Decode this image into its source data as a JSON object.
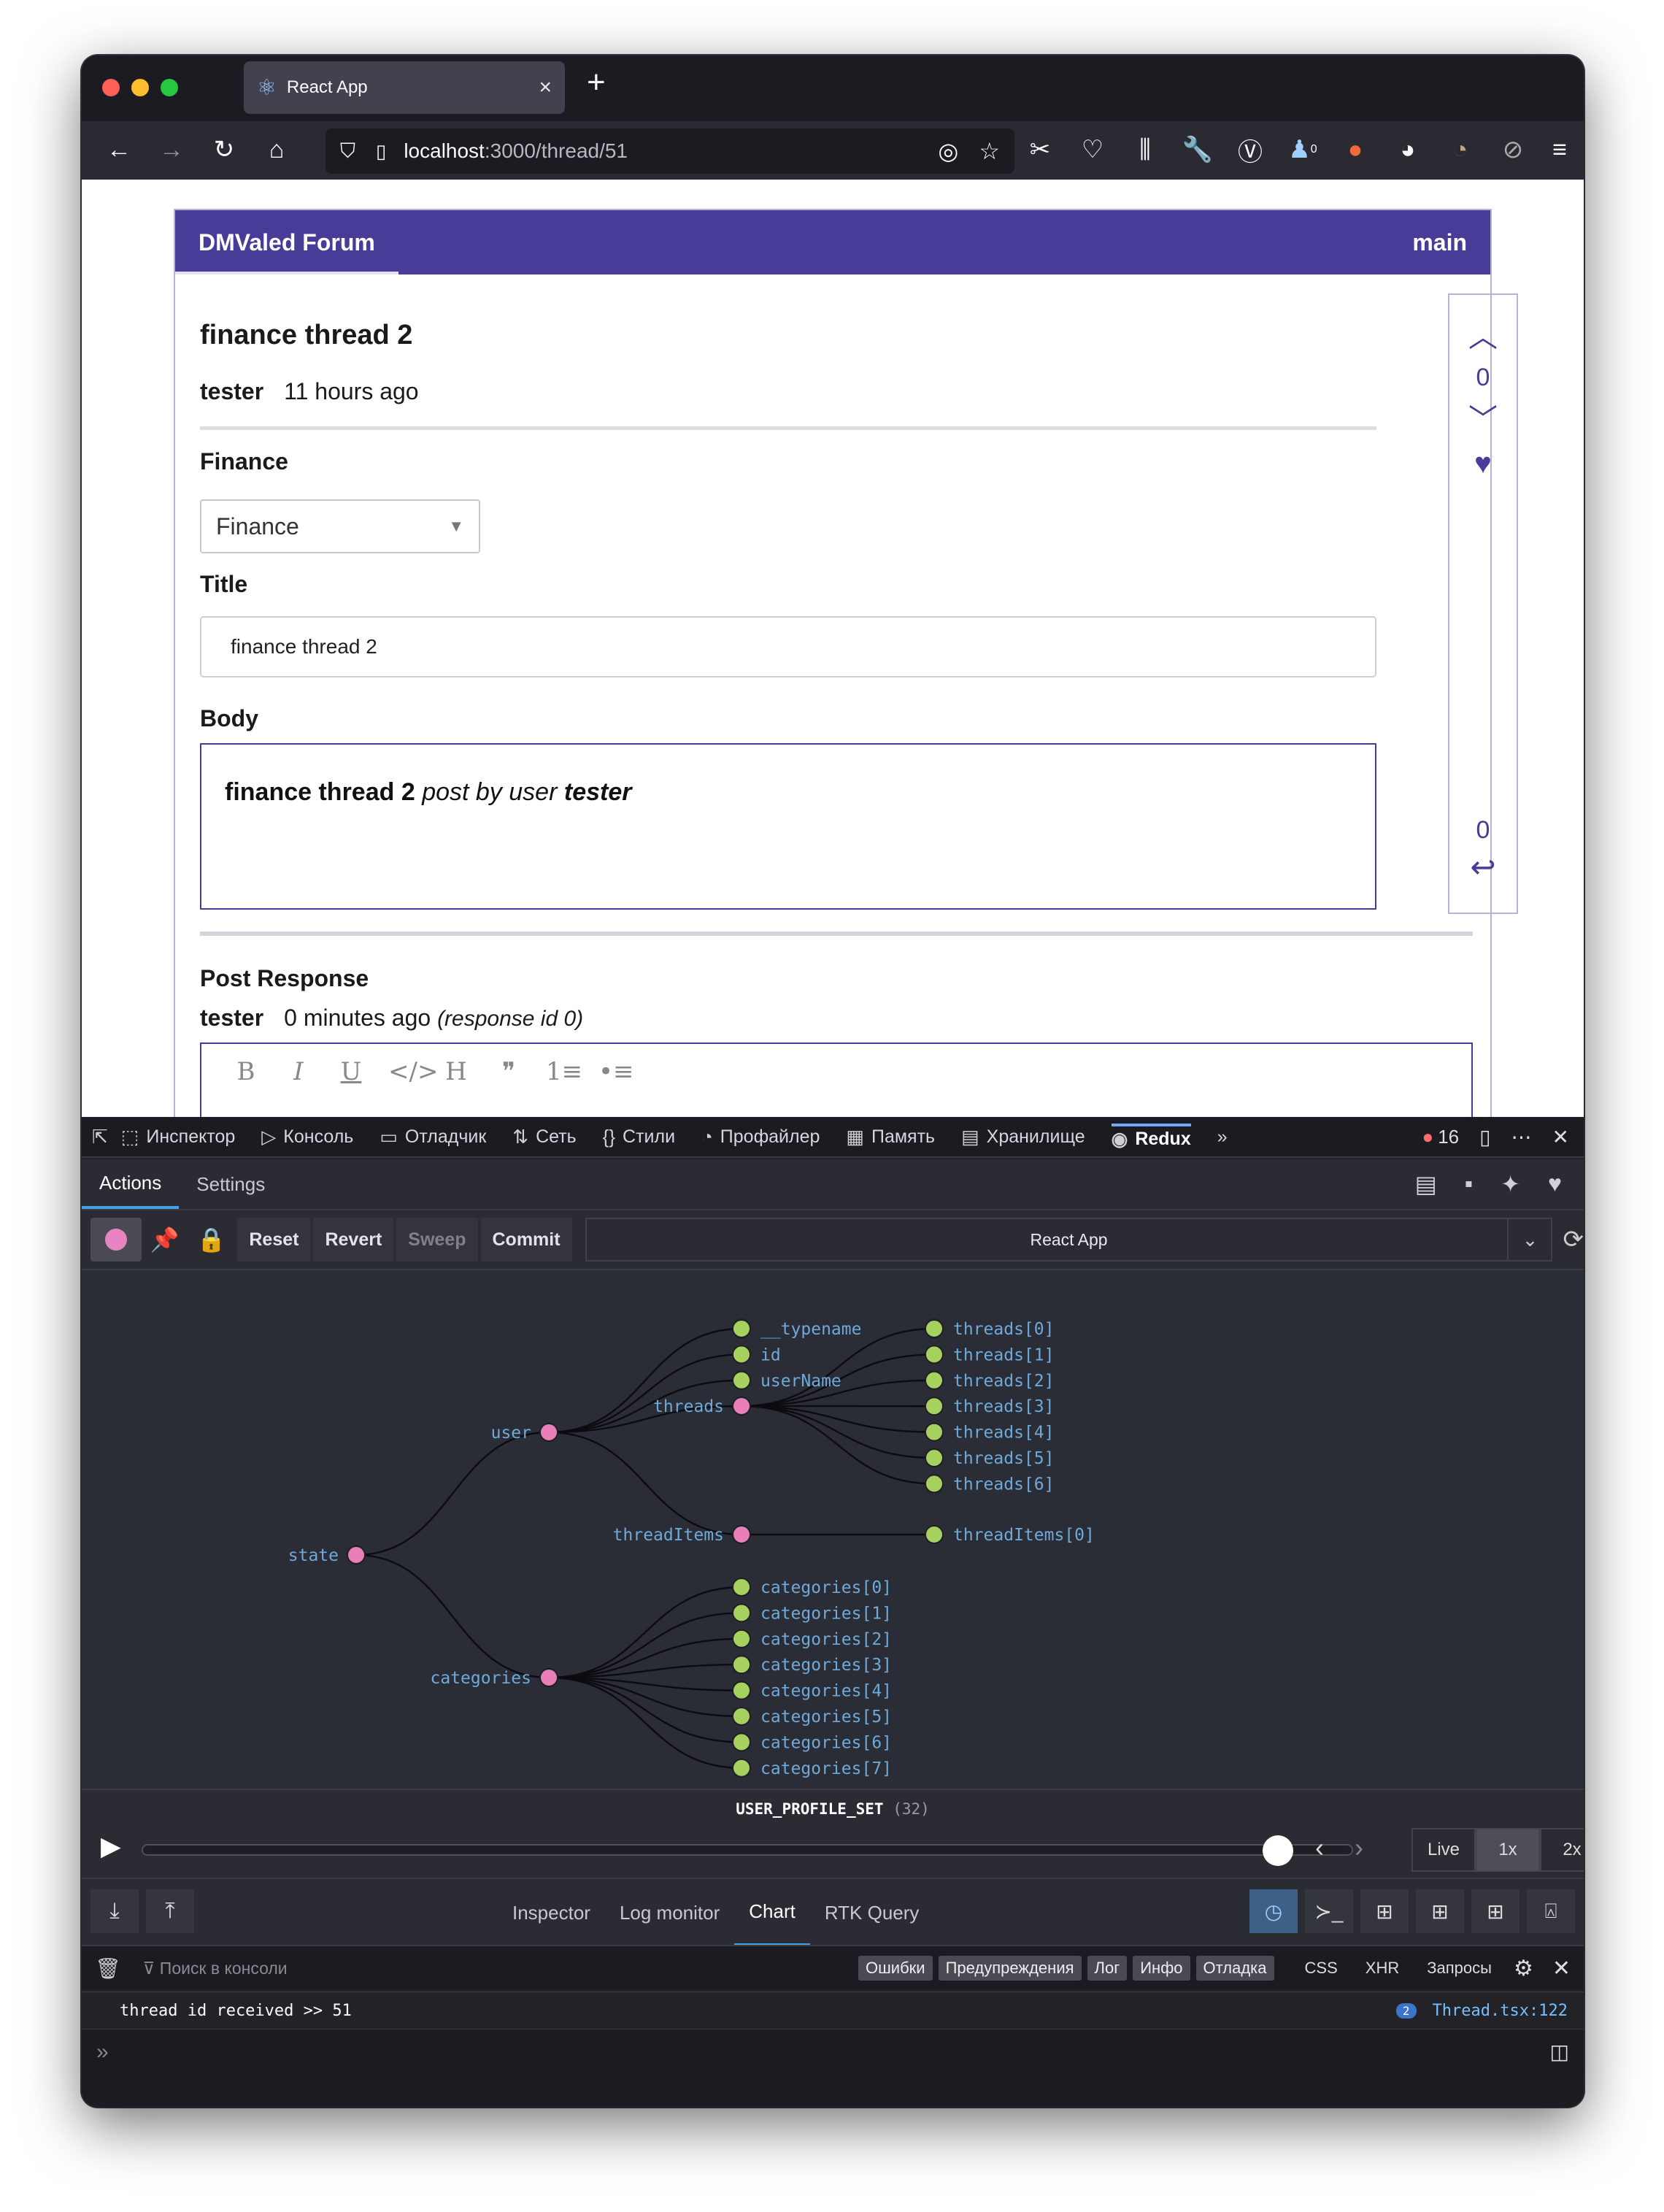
{
  "browser": {
    "tab_title": "React App",
    "tab_close": "×",
    "new_tab": "+",
    "url_host": "localhost",
    "url_path": ":3000/thread/51",
    "toolbar_badge": "0"
  },
  "header": {
    "brand": "DMValed Forum",
    "nav_main": "main"
  },
  "thread": {
    "title": "finance thread 2",
    "author": "tester",
    "time": "11 hours ago",
    "category_label": "Finance",
    "category_value": "Finance",
    "title_label": "Title",
    "title_value": "finance thread 2",
    "body_label": "Body",
    "body_bold": "finance thread 2",
    "body_italic": "post by user",
    "body_author": "tester"
  },
  "side": {
    "votes": "0",
    "responses": "0"
  },
  "response": {
    "heading": "Post Response",
    "author": "tester",
    "time": "0 minutes ago",
    "note": "(response id 0)"
  },
  "editor_tools": [
    "B",
    "I",
    "U",
    "</>",
    "H",
    "❞",
    "1≡",
    "•≡"
  ],
  "devtools": {
    "tabs": [
      {
        "icon": "⬚",
        "label": "Инспектор"
      },
      {
        "icon": "▷",
        "label": "Консоль"
      },
      {
        "icon": "▭",
        "label": "Отладчик"
      },
      {
        "icon": "⇅",
        "label": "Сеть"
      },
      {
        "icon": "{}",
        "label": "Стили"
      },
      {
        "icon": "◔",
        "label": "Профайлер"
      },
      {
        "icon": "▦",
        "label": "Память"
      },
      {
        "icon": "▤",
        "label": "Хранилище"
      },
      {
        "icon": "◉",
        "label": "Redux"
      }
    ],
    "error_count": "16",
    "redux_tabs": [
      "Actions",
      "Settings"
    ],
    "ctrl_buttons": [
      "Reset",
      "Revert",
      "Sweep",
      "Commit"
    ],
    "instance": "React App",
    "action_name": "USER_PROFILE_SET",
    "action_index": "(32)",
    "speeds": [
      "Live",
      "1x",
      "2x"
    ],
    "monitors": [
      "Inspector",
      "Log monitor",
      "Chart",
      "RTK Query"
    ],
    "console_filter": "Поиск в консоли",
    "console_levels": [
      "Ошибки",
      "Предупреждения",
      "Лог",
      "Инфо",
      "Отладка"
    ],
    "console_extra": [
      "CSS",
      "XHR",
      "Запросы"
    ],
    "console_message": "thread id received >>  51",
    "console_count": "2",
    "console_source": "Thread.tsx:122"
  },
  "tree": {
    "root": "state",
    "user": "user",
    "categories": "categories",
    "threads": "threads",
    "threadItems": "threadItems",
    "user_leaves": [
      "__typename",
      "id",
      "userName"
    ],
    "thread_children": [
      "threads[0]",
      "threads[1]",
      "threads[2]",
      "threads[3]",
      "threads[4]",
      "threads[5]",
      "threads[6]"
    ],
    "threadItems_children": [
      "threadItems[0]"
    ],
    "category_children": [
      "categories[0]",
      "categories[1]",
      "categories[2]",
      "categories[3]",
      "categories[4]",
      "categories[5]",
      "categories[6]",
      "categories[7]"
    ],
    "colors": {
      "branch": "#e97fb8",
      "leaf": "#a6d15f",
      "label": "#6fa9d8",
      "link": "#0c0c10"
    }
  }
}
